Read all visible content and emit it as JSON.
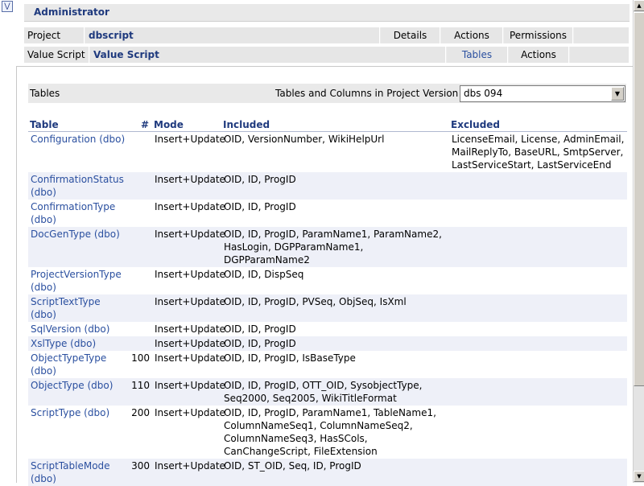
{
  "header": {
    "title": "Administrator"
  },
  "project_row": {
    "label": "Project",
    "value": "dbscript",
    "buttons": [
      "Details",
      "Actions",
      "Permissions"
    ]
  },
  "script_row": {
    "label": "Value Script",
    "value": "Value Script",
    "buttons": [
      "Tables",
      "Actions"
    ]
  },
  "toolbar": {
    "label": "Tables",
    "version_label": "Tables and Columns in Project Version",
    "version_value": "dbs 094"
  },
  "table": {
    "columns": [
      "Table",
      "#",
      "Mode",
      "Included",
      "Excluded"
    ],
    "rows": [
      {
        "table": "Configuration (dbo)",
        "num": "",
        "mode": "Insert+Update",
        "included": "OID, VersionNumber, WikiHelpUrl",
        "excluded": "LicenseEmail, License, AdminEmail, MailReplyTo, BaseURL, SmtpServer, LastServiceStart, LastServiceEnd"
      },
      {
        "table": "ConfirmationStatus (dbo)",
        "num": "",
        "mode": "Insert+Update",
        "included": "OID, ID, ProgID",
        "excluded": ""
      },
      {
        "table": "ConfirmationType (dbo)",
        "num": "",
        "mode": "Insert+Update",
        "included": "OID, ID, ProgID",
        "excluded": ""
      },
      {
        "table": "DocGenType (dbo)",
        "num": "",
        "mode": "Insert+Update",
        "included": "OID, ID, ProgID, ParamName1, ParamName2, HasLogin, DGPParamName1, DGPParamName2",
        "excluded": ""
      },
      {
        "table": "ProjectVersionType (dbo)",
        "num": "",
        "mode": "Insert+Update",
        "included": "OID, ID, DispSeq",
        "excluded": ""
      },
      {
        "table": "ScriptTextType (dbo)",
        "num": "",
        "mode": "Insert+Update",
        "included": "OID, ID, ProgID, PVSeq, ObjSeq, IsXml",
        "excluded": ""
      },
      {
        "table": "SqlVersion (dbo)",
        "num": "",
        "mode": "Insert+Update",
        "included": "OID, ID, ProgID",
        "excluded": ""
      },
      {
        "table": "XslType (dbo)",
        "num": "",
        "mode": "Insert+Update",
        "included": "OID, ID, ProgID",
        "excluded": ""
      },
      {
        "table": "ObjectTypeType (dbo)",
        "num": "100",
        "mode": "Insert+Update",
        "included": "OID, ID, ProgID, IsBaseType",
        "excluded": ""
      },
      {
        "table": "ObjectType (dbo)",
        "num": "110",
        "mode": "Insert+Update",
        "included": "OID, ID, ProgID, OTT_OID, SysobjectType, Seq2000, Seq2005, WikiTitleFormat",
        "excluded": ""
      },
      {
        "table": "ScriptType (dbo)",
        "num": "200",
        "mode": "Insert+Update",
        "included": "OID, ID, ProgID, ParamName1, TableName1, ColumnNameSeq1, ColumnNameSeq2, ColumnNameSeq3, HasSCols, CanChangeScript, FileExtension",
        "excluded": ""
      },
      {
        "table": "ScriptTableMode (dbo)",
        "num": "300",
        "mode": "Insert+Update",
        "included": "OID, ST_OID, Seq, ID, ProgID",
        "excluded": ""
      }
    ]
  }
}
